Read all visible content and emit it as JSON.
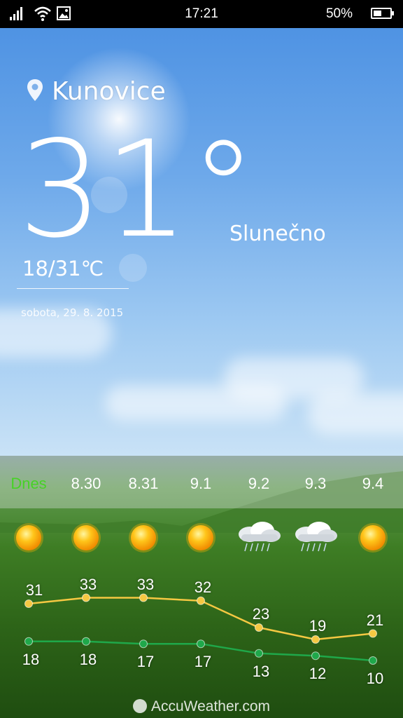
{
  "status_bar": {
    "time": "17:21",
    "battery_text": "50%",
    "battery_level": 0.5,
    "icons": [
      "signal-icon",
      "wifi-icon",
      "image-icon"
    ]
  },
  "current": {
    "location": "Kunovice",
    "temperature": "31°",
    "condition": "Slunečno",
    "range": "18/31℃",
    "date": "sobota, 29. 8. 2015"
  },
  "forecast": [
    {
      "label": "Dnes",
      "icon": "sunny-icon",
      "high": 31,
      "low": 18
    },
    {
      "label": "8.30",
      "icon": "sunny-icon",
      "high": 33,
      "low": 18
    },
    {
      "label": "8.31",
      "icon": "sunny-icon",
      "high": 33,
      "low": 17
    },
    {
      "label": "9.1",
      "icon": "sunny-icon",
      "high": 32,
      "low": 17
    },
    {
      "label": "9.2",
      "icon": "thunderstorm-icon",
      "high": 23,
      "low": 13
    },
    {
      "label": "9.3",
      "icon": "thunderstorm-icon",
      "high": 19,
      "low": 12
    },
    {
      "label": "9.4",
      "icon": "sunny-icon",
      "high": 21,
      "low": 10
    }
  ],
  "colors": {
    "today": "#47d226",
    "high_line": "#f5c842",
    "low_line": "#1fa84a"
  },
  "footer": {
    "brand": "AccuWeather.com"
  }
}
